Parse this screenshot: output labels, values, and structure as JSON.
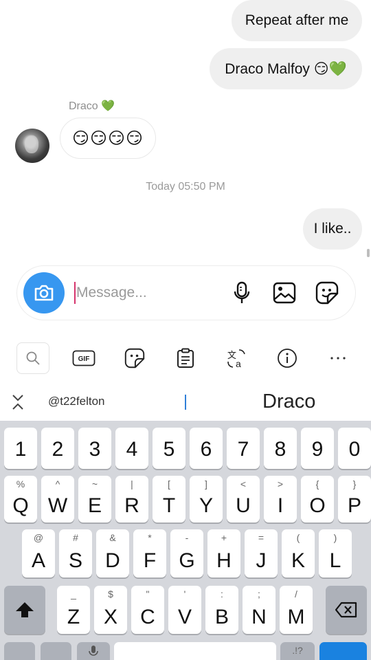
{
  "chat": {
    "messages_sent": [
      {
        "text": "Repeat after me"
      },
      {
        "text": "Draco Malfoy 😏💚"
      }
    ],
    "received": {
      "sender": "Draco 💚",
      "text": "😏😏😏😏"
    },
    "timestamp": "Today 05:50 PM",
    "last_sent": "I like.."
  },
  "composer": {
    "placeholder": "Message...",
    "icons": [
      "camera-icon",
      "microphone-icon",
      "gallery-icon",
      "sticker-icon"
    ],
    "accent": "#3797f0"
  },
  "toolbar": {
    "items": [
      "search-icon",
      "gif-icon",
      "sticker-icon",
      "clipboard-icon",
      "translate-icon",
      "info-icon",
      "more-icon"
    ],
    "gif_label": "GIF"
  },
  "suggestions": {
    "items": [
      "@t22felton",
      "Draco"
    ]
  },
  "keyboard": {
    "numbers": [
      "1",
      "2",
      "3",
      "4",
      "5",
      "6",
      "7",
      "8",
      "9",
      "0"
    ],
    "row1": [
      {
        "main": "Q",
        "sub": "%"
      },
      {
        "main": "W",
        "sub": "^"
      },
      {
        "main": "E",
        "sub": "~"
      },
      {
        "main": "R",
        "sub": "|"
      },
      {
        "main": "T",
        "sub": "["
      },
      {
        "main": "Y",
        "sub": "]"
      },
      {
        "main": "U",
        "sub": "<"
      },
      {
        "main": "I",
        "sub": ">"
      },
      {
        "main": "O",
        "sub": "{"
      },
      {
        "main": "P",
        "sub": "}"
      }
    ],
    "row2": [
      {
        "main": "A",
        "sub": "@"
      },
      {
        "main": "S",
        "sub": "#"
      },
      {
        "main": "D",
        "sub": "&"
      },
      {
        "main": "F",
        "sub": "*"
      },
      {
        "main": "G",
        "sub": "-"
      },
      {
        "main": "H",
        "sub": "+"
      },
      {
        "main": "J",
        "sub": "="
      },
      {
        "main": "K",
        "sub": "("
      },
      {
        "main": "L",
        "sub": ")"
      }
    ],
    "row3": [
      {
        "main": "Z",
        "sub": "_"
      },
      {
        "main": "X",
        "sub": "$"
      },
      {
        "main": "C",
        "sub": "\""
      },
      {
        "main": "V",
        "sub": "'"
      },
      {
        "main": "B",
        "sub": ":"
      },
      {
        "main": "N",
        "sub": ";"
      },
      {
        "main": "M",
        "sub": "/"
      }
    ],
    "bottom_sub": ".!?",
    "colors": {
      "background": "#d5d7dc",
      "key": "#ffffff",
      "special": "#adb1b9",
      "action": "#1a82e0"
    }
  }
}
